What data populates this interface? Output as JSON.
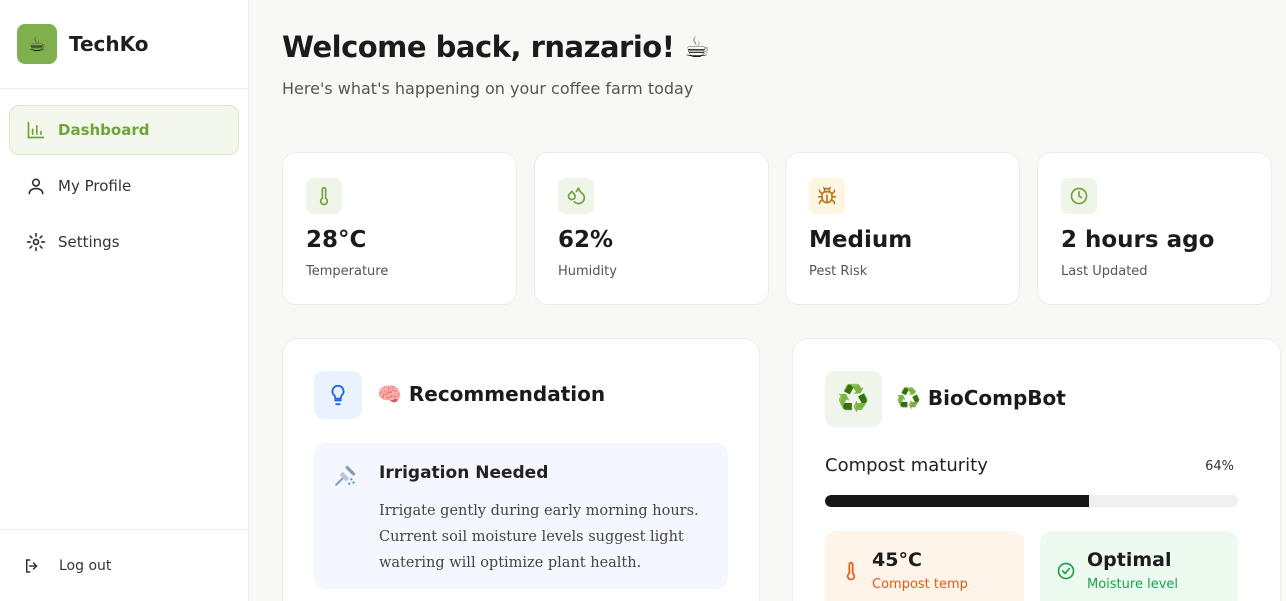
{
  "app": {
    "name": "TechKo",
    "logo_icon": "coffee-cup-icon"
  },
  "sidebar": {
    "items": [
      {
        "label": "Dashboard",
        "icon": "bar-chart-icon",
        "active": true
      },
      {
        "label": "My Profile",
        "icon": "user-icon",
        "active": false
      },
      {
        "label": "Settings",
        "icon": "gear-icon",
        "active": false
      }
    ],
    "logout_label": "Log out"
  },
  "header": {
    "welcome": "Welcome back, rnazario! ☕",
    "subtitle": "Here's what's happening on your coffee farm today"
  },
  "stats": [
    {
      "value": "28°C",
      "label": "Temperature",
      "icon": "thermometer-icon",
      "color": "#6ea43b"
    },
    {
      "value": "62%",
      "label": "Humidity",
      "icon": "droplets-icon",
      "color": "#6ea43b"
    },
    {
      "value": "Medium",
      "label": "Pest Risk",
      "icon": "bug-icon",
      "color": "#b7791f"
    },
    {
      "value": "2 hours ago",
      "label": "Last Updated",
      "icon": "clock-icon",
      "color": "#6ea43b"
    }
  ],
  "recommendation": {
    "title": "🧠 Recommendation",
    "item_title": "Irrigation Needed",
    "item_text": "Irrigate gently during early morning hours. Current soil moisture levels suggest light watering will optimize plant health."
  },
  "biocompbot": {
    "title": "♻️ BioCompBot",
    "maturity_label": "Compost maturity",
    "maturity_text": "64%",
    "maturity_fraction": 0.64,
    "temp_value": "45°C",
    "temp_label": "Compost temp",
    "moisture_value": "Optimal",
    "moisture_label": "Moisture level"
  },
  "colors": {
    "accent": "#7fb04d",
    "compost_orange": "#ea580c",
    "moisture_green": "#16a34a"
  }
}
